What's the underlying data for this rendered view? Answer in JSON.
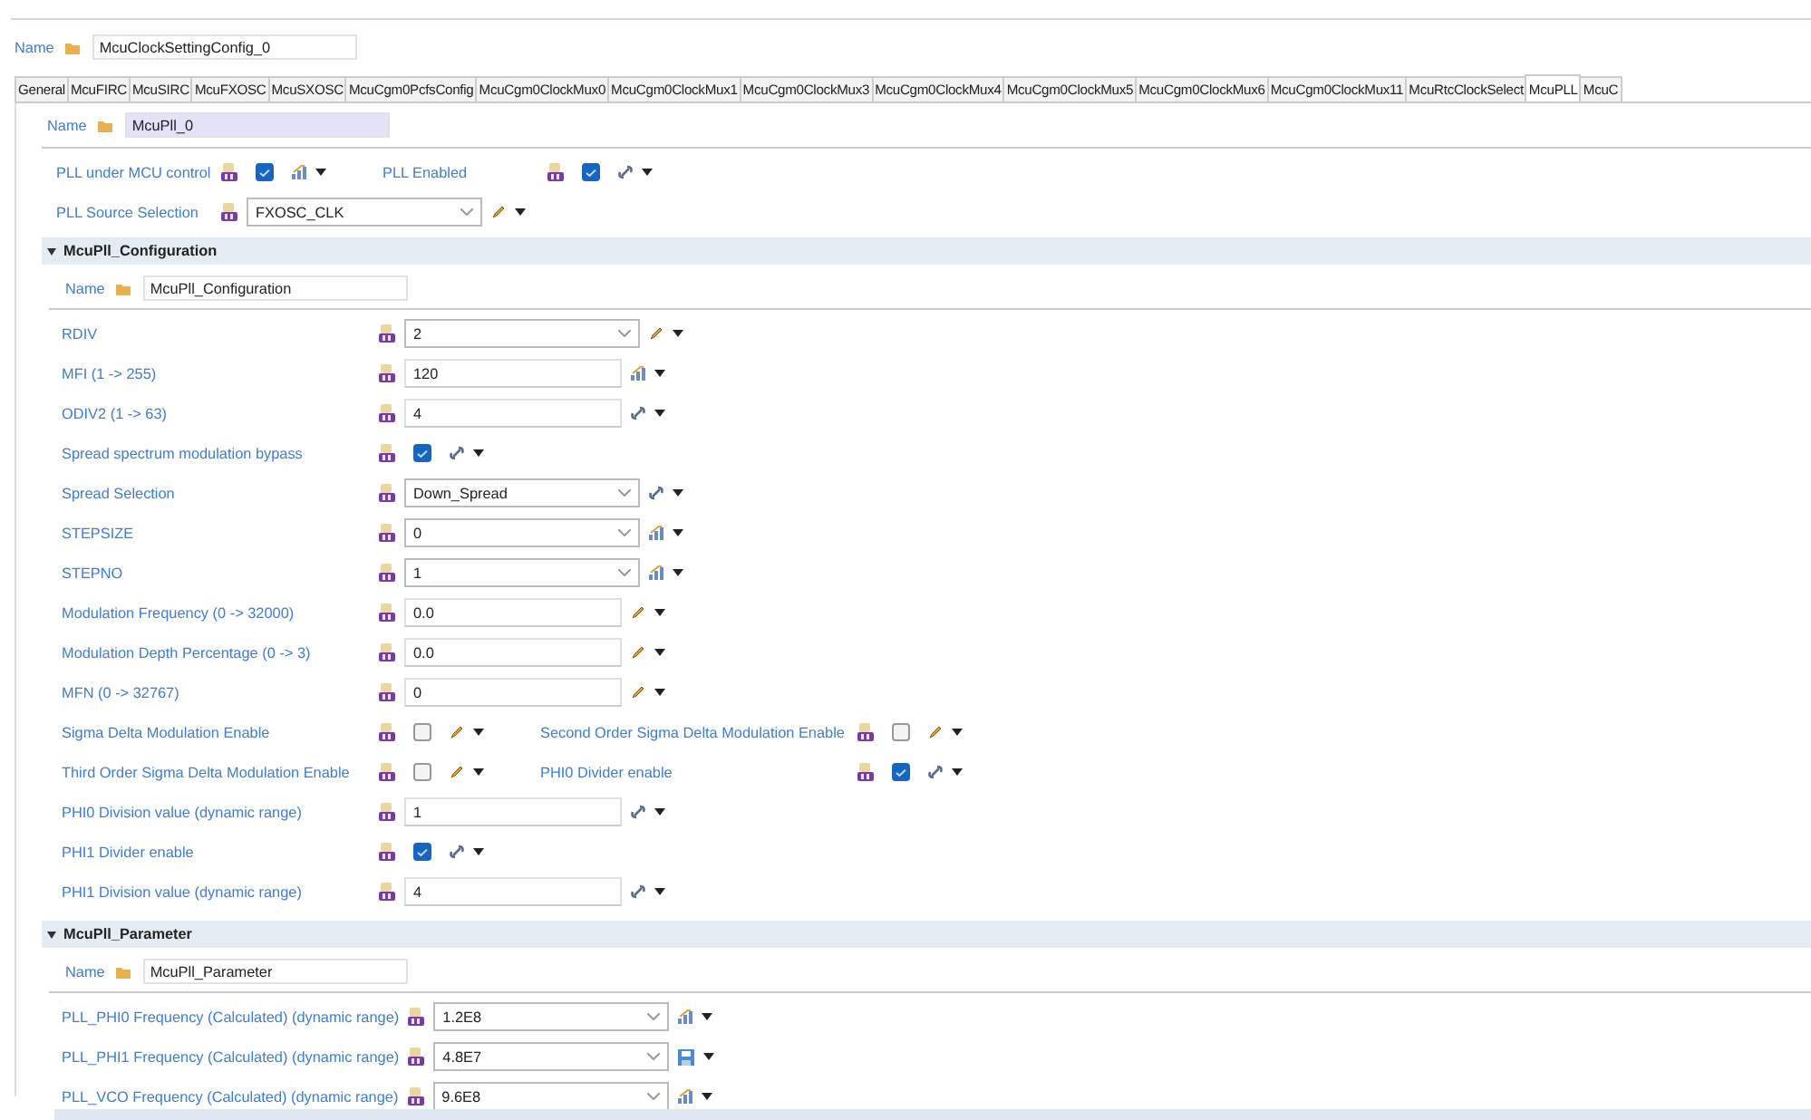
{
  "name_field": {
    "label": "Name",
    "value": "McuClockSettingConfig_0"
  },
  "tabs": [
    {
      "label": "General",
      "selected": false
    },
    {
      "label": "McuFIRC",
      "selected": false
    },
    {
      "label": "McuSIRC",
      "selected": false
    },
    {
      "label": "McuFXOSC",
      "selected": false
    },
    {
      "label": "McuSXOSC",
      "selected": false
    },
    {
      "label": "McuCgm0PcfsConfig",
      "selected": false
    },
    {
      "label": "McuCgm0ClockMux0",
      "selected": false
    },
    {
      "label": "McuCgm0ClockMux1",
      "selected": false
    },
    {
      "label": "McuCgm0ClockMux3",
      "selected": false
    },
    {
      "label": "McuCgm0ClockMux4",
      "selected": false
    },
    {
      "label": "McuCgm0ClockMux5",
      "selected": false
    },
    {
      "label": "McuCgm0ClockMux6",
      "selected": false
    },
    {
      "label": "McuCgm0ClockMux11",
      "selected": false
    },
    {
      "label": "McuRtcClockSelect",
      "selected": false
    },
    {
      "label": "McuPLL",
      "selected": true
    },
    {
      "label": "McuC",
      "selected": false
    }
  ],
  "pll": {
    "name": {
      "label": "Name",
      "value": "McuPll_0"
    },
    "rows": [
      {
        "fields": [
          {
            "label": "PLL under MCU control",
            "kind": "check",
            "checked": true,
            "tool": {
              "kind": "bars"
            }
          },
          {
            "label": "PLL Enabled",
            "kind": "check",
            "checked": true,
            "tool": {
              "kind": "link"
            }
          }
        ]
      },
      {
        "fields": [
          {
            "label": "PLL Source Selection",
            "kind": "combo",
            "value": "FXOSC_CLK",
            "tool": {
              "kind": "pencil"
            }
          }
        ]
      }
    ]
  },
  "sections": [
    {
      "title": "McuPll_Configuration",
      "expanded": true,
      "name": {
        "label": "Name",
        "value": "McuPll_Configuration"
      },
      "rows": [
        {
          "fields": [
            {
              "label": "RDIV",
              "kind": "combo",
              "value": "2",
              "tool": {
                "kind": "pencil"
              }
            }
          ]
        },
        {
          "fields": [
            {
              "label": "MFI (1 -> 255)",
              "kind": "text",
              "value": "120",
              "tool": {
                "kind": "bars"
              }
            }
          ]
        },
        {
          "fields": [
            {
              "label": "ODIV2 (1 -> 63)",
              "kind": "text",
              "value": "4",
              "tool": {
                "kind": "link"
              }
            }
          ]
        },
        {
          "fields": [
            {
              "label": "Spread spectrum modulation bypass",
              "kind": "check",
              "checked": true,
              "tool": {
                "kind": "link"
              }
            }
          ]
        },
        {
          "fields": [
            {
              "label": "Spread Selection",
              "kind": "combo",
              "value": "Down_Spread",
              "tool": {
                "kind": "link"
              }
            }
          ]
        },
        {
          "fields": [
            {
              "label": "STEPSIZE",
              "kind": "combo",
              "value": "0",
              "tool": {
                "kind": "bars"
              }
            }
          ]
        },
        {
          "fields": [
            {
              "label": "STEPNO",
              "kind": "combo",
              "value": "1",
              "tool": {
                "kind": "bars"
              }
            }
          ]
        },
        {
          "fields": [
            {
              "label": "Modulation Frequency (0 -> 32000)",
              "kind": "text",
              "value": "0.0",
              "tool": {
                "kind": "pencil"
              }
            }
          ]
        },
        {
          "fields": [
            {
              "label": "Modulation Depth Percentage (0 -> 3)",
              "kind": "text",
              "value": "0.0",
              "tool": {
                "kind": "pencil"
              }
            }
          ]
        },
        {
          "fields": [
            {
              "label": "MFN (0 -> 32767)",
              "kind": "text",
              "value": "0",
              "tool": {
                "kind": "pencil"
              }
            }
          ]
        },
        {
          "fields": [
            {
              "label": "Sigma Delta Modulation Enable",
              "kind": "check",
              "checked": false,
              "tool": {
                "kind": "pencil"
              }
            },
            {
              "label": "Second Order Sigma Delta Modulation Enable",
              "kind": "check",
              "checked": false,
              "tool": {
                "kind": "pencil"
              }
            }
          ]
        },
        {
          "fields": [
            {
              "label": "Third Order Sigma Delta Modulation Enable",
              "kind": "check",
              "checked": false,
              "tool": {
                "kind": "pencil"
              }
            },
            {
              "label": "PHI0 Divider enable",
              "kind": "check",
              "checked": true,
              "tool": {
                "kind": "link"
              }
            }
          ]
        },
        {
          "fields": [
            {
              "label": "PHI0 Division value (dynamic range)",
              "kind": "text",
              "value": "1",
              "tool": {
                "kind": "link"
              }
            }
          ]
        },
        {
          "fields": [
            {
              "label": "PHI1 Divider enable",
              "kind": "check",
              "checked": true,
              "tool": {
                "kind": "link"
              }
            }
          ]
        },
        {
          "fields": [
            {
              "label": "PHI1 Division value (dynamic range)",
              "kind": "text",
              "value": "4",
              "tool": {
                "kind": "link"
              }
            }
          ]
        }
      ]
    },
    {
      "title": "McuPll_Parameter",
      "expanded": true,
      "name": {
        "label": "Name",
        "value": "McuPll_Parameter"
      },
      "rows": [
        {
          "fields": [
            {
              "label": "PLL_PHI0 Frequency (Calculated) (dynamic range)",
              "kind": "combo",
              "value": "1.2E8",
              "tool": {
                "kind": "bars"
              }
            }
          ]
        },
        {
          "fields": [
            {
              "label": "PLL_PHI1 Frequency (Calculated) (dynamic range)",
              "kind": "combo",
              "value": "4.8E7",
              "tool": {
                "kind": "save"
              }
            }
          ]
        },
        {
          "fields": [
            {
              "label": "PLL_VCO Frequency (Calculated) (dynamic range)",
              "kind": "combo",
              "value": "9.6E8",
              "tool": {
                "kind": "bars"
              }
            }
          ]
        }
      ]
    }
  ]
}
